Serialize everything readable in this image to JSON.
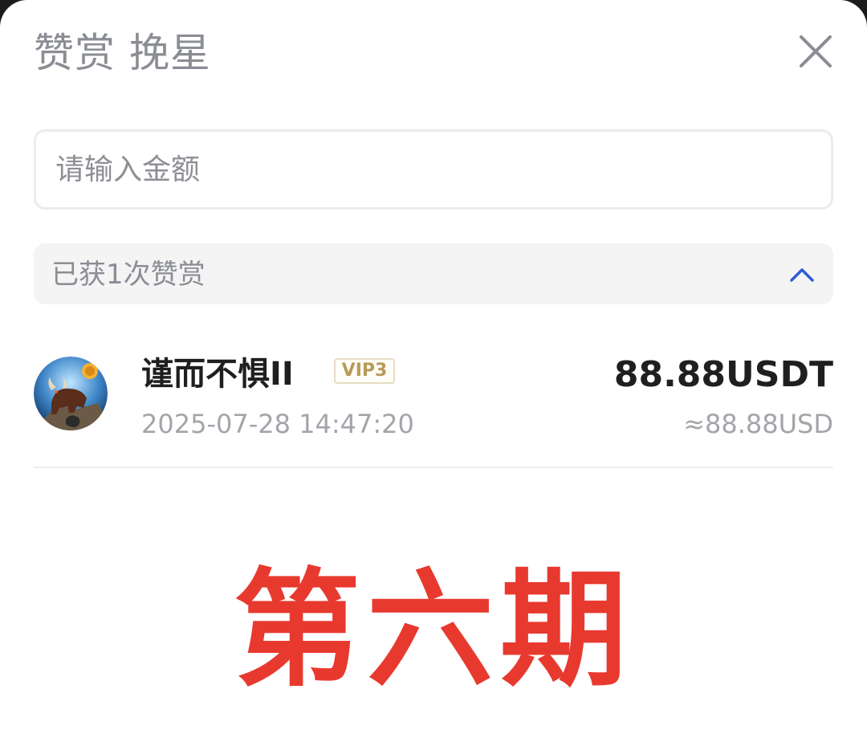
{
  "header": {
    "title": "赞赏 挽星",
    "close_icon": "close-icon"
  },
  "input": {
    "placeholder": "请输入金额",
    "value": ""
  },
  "tips_summary": {
    "label": "已获1次赞赏",
    "toggle_icon": "chevron-up-icon",
    "accent_color": "#2f5bd6"
  },
  "tips": [
    {
      "avatar_icon": "bull-avatar",
      "username": "谨而不惧II",
      "vip_badge": "VIP3",
      "timestamp": "2025-07-28 14:47:20",
      "amount": "88.88USDT",
      "amount_usd": "≈88.88USD"
    }
  ],
  "overlay_text": "第六期",
  "colors": {
    "overlay": "#e8392f",
    "vip_gold": "#b89a5a"
  }
}
